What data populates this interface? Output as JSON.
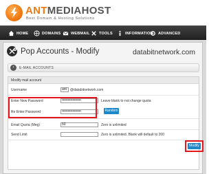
{
  "brand": {
    "name_accent": "ANT",
    "name_rest": "MEDIAHOST",
    "tagline": "Best Domain & Hosting Solutions"
  },
  "nav": {
    "items": [
      {
        "label": "HOME",
        "icon": "home-icon"
      },
      {
        "label": "DOMAINS",
        "icon": "globe-icon"
      },
      {
        "label": "WEBMAIL",
        "icon": "mail-icon"
      },
      {
        "label": "TOOLS",
        "icon": "tools-icon"
      },
      {
        "label": "INFORMATION",
        "icon": "info-icon"
      },
      {
        "label": "ADVANCED",
        "icon": "advanced-icon"
      }
    ]
  },
  "page": {
    "title": "Pop Accounts - Modify",
    "domain": "databitnetwork.com",
    "back_label": "E-MAIL ACCOUNTS"
  },
  "form": {
    "header": "Modify mail account",
    "username_label": "Username",
    "username_value": "ant",
    "username_suffix": "@databitnetwork.com",
    "new_password_label": "Enter New Password",
    "new_password_value": "••••••••••••••••",
    "new_password_hint": "Leave blank to not change quota",
    "reenter_label": "Re Enter Password",
    "reenter_value": "••••••••••••••••",
    "random_label": "Random",
    "quota_label": "Email Quota (Meg)",
    "quota_value": "50",
    "quota_hint": "Zero is unlimited",
    "send_limit_label": "Send Limit",
    "send_limit_value": "",
    "send_limit_hint": "Zero is unlimited. Blank will default to 200",
    "modify_label": "Modify"
  },
  "colors": {
    "brand_orange": "#f07b12",
    "highlight_red": "#e5141b",
    "button_blue": "#1e87c8"
  }
}
